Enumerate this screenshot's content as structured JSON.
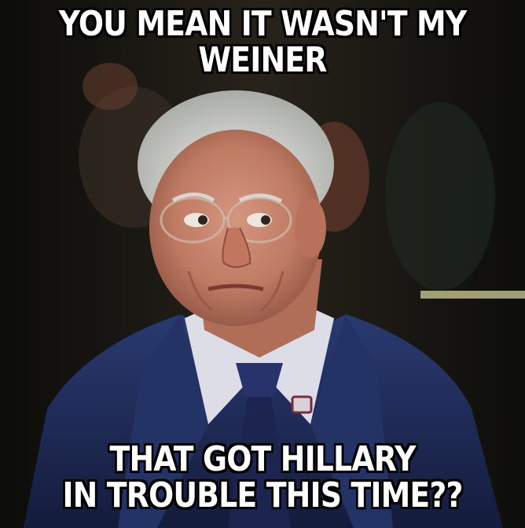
{
  "meme": {
    "top_caption": [
      "YOU MEAN IT WASN'T MY",
      "WEINER"
    ],
    "bottom_caption": [
      "THAT GOT HILLARY",
      "IN TROUBLE THIS TIME??"
    ]
  },
  "colors": {
    "background": "#0b0b0b",
    "suit": "#1e2a55",
    "tie": "#1c2550",
    "shirt": "#dcdde6",
    "skin": "#c7826a",
    "hair": "#d9dcdc",
    "caption_text": "#ffffff",
    "caption_outline": "#000000"
  }
}
